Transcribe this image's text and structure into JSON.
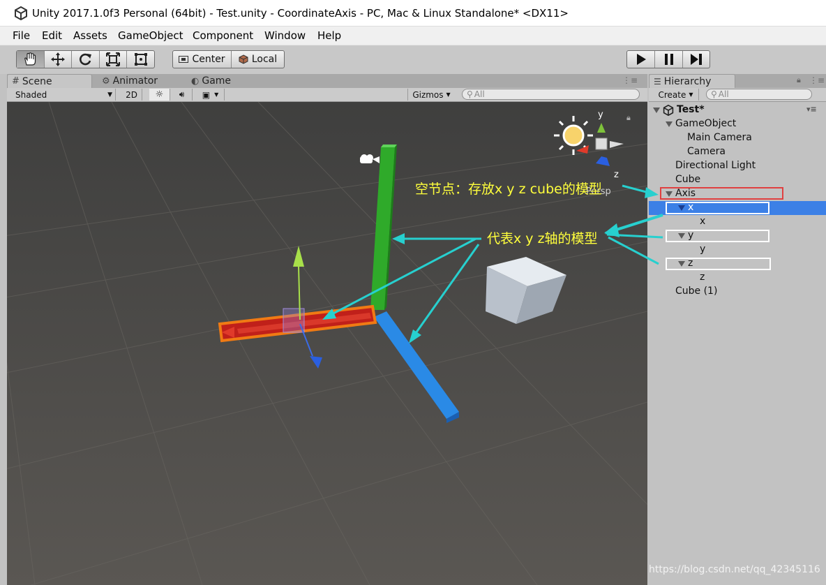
{
  "window": {
    "title": "Unity 2017.1.0f3 Personal (64bit) - Test.unity - CoordinateAxis - PC, Mac & Linux Standalone* <DX11>",
    "logo": "unity-logo-icon"
  },
  "menu": [
    "File",
    "Edit",
    "Assets",
    "GameObject",
    "Component",
    "Window",
    "Help"
  ],
  "toolbar": {
    "tools": [
      "hand-tool-icon",
      "move-tool-icon",
      "rotate-tool-icon",
      "scale-tool-icon",
      "rect-tool-icon"
    ],
    "pivot": "Center",
    "space": "Local",
    "play": [
      "play-icon",
      "pause-icon",
      "step-icon"
    ]
  },
  "scene": {
    "tabs": [
      "Scene",
      "Animator",
      "Game"
    ],
    "shading": "Shaded",
    "mode_2d": "2D",
    "gizmos": "Gizmos",
    "search_placeholder": "All",
    "persp": "Persp",
    "gizmo_axes": {
      "y": "y",
      "z": "z"
    }
  },
  "hierarchy": {
    "tab": "Hierarchy",
    "create": "Create",
    "search_placeholder": "All",
    "scene_name": "Test*",
    "items": [
      {
        "label": "GameObject",
        "depth": 1,
        "expanded": true
      },
      {
        "label": "Main Camera",
        "depth": 2
      },
      {
        "label": "Camera",
        "depth": 2
      },
      {
        "label": "Directional Light",
        "depth": 1
      },
      {
        "label": "Cube",
        "depth": 1
      },
      {
        "label": "Axis",
        "depth": 1,
        "expanded": true
      },
      {
        "label": "x",
        "depth": 2,
        "expanded": true,
        "selected": true
      },
      {
        "label": "x",
        "depth": 3
      },
      {
        "label": "y",
        "depth": 2,
        "expanded": true
      },
      {
        "label": "y",
        "depth": 3
      },
      {
        "label": "z",
        "depth": 2,
        "expanded": true
      },
      {
        "label": "z",
        "depth": 3
      },
      {
        "label": "Cube (1)",
        "depth": 1
      }
    ]
  },
  "annotations": {
    "empty_node": "空节点：存放x y z cube的模型",
    "axis_models": "代表x y z轴的模型"
  },
  "colors": {
    "x_axis": "#c0201a",
    "y_axis": "#2faa2a",
    "z_axis": "#2a8ae6",
    "annotation": "#ffff3c",
    "arrow": "#27d0cf",
    "selection": "#3c80e6"
  },
  "watermark": "https://blog.csdn.net/qq_42345116"
}
